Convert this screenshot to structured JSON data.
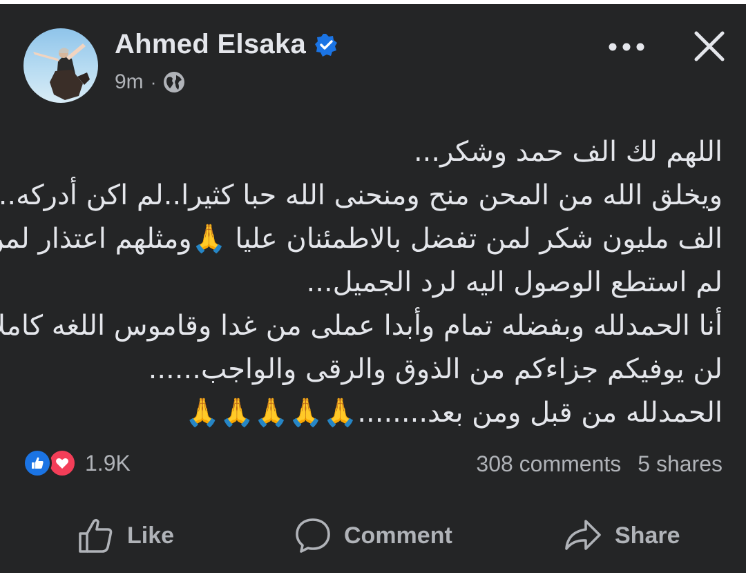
{
  "post": {
    "author_name": "Ahmed Elsaka",
    "verified_icon": "verified-badge-icon",
    "time": "9m",
    "separator": "·",
    "audience_icon": "globe-icon",
    "lines": [
      "اللهم لك الف حمد وشكر...",
      "ويخلق الله من المحن منح ومنحنى الله حبا كثيرا..لم اكن أدركه..",
      "الف مليون شكر لمن تفضل بالاطمئنان عليا 🙏ومثلهم اعتذار لمن",
      "لم استطع الوصول اليه لرد الجميل...",
      "أنا الحمدلله وبفضله تمام وأبدا عملى من غدا وقاموس اللغه كاملا",
      "لن يوفيكم جزاءكم من الذوق والرقى والواجب......",
      "الحمدلله من قبل ومن بعد........🙏🙏🙏🙏🙏"
    ]
  },
  "reactions": {
    "count": "1.9K",
    "icons": [
      "like-icon",
      "love-icon"
    ]
  },
  "stats": {
    "comments": "308 comments",
    "shares": "5 shares"
  },
  "actions": {
    "like": "Like",
    "comment": "Comment",
    "share": "Share"
  },
  "colors": {
    "background": "#242526",
    "text": "#e4e6eb",
    "muted": "#b0b3b8",
    "accent": "#1b74e4",
    "love": "#f33e58"
  }
}
